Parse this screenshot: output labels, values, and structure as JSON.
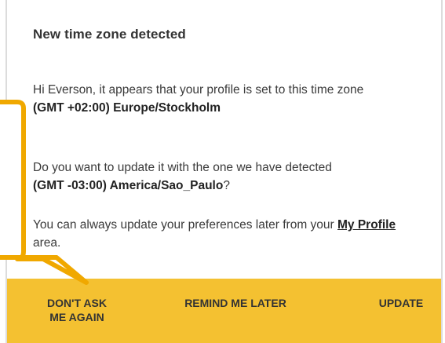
{
  "dialog": {
    "title": "New time zone detected",
    "greeting": "Hi Everson, it appears that your profile is set to this time zone",
    "current_zone": "(GMT +02:00) Europe/Stockholm",
    "question": "Do you want to update it with the one we have detected",
    "detected_zone": "(GMT -03:00) America/Sao_Paulo",
    "question_end": "?",
    "note_prefix": "You can always update your preferences later from your ",
    "note_link": "My Profile",
    "note_suffix": " area."
  },
  "footer": {
    "dont_ask_label": "DON'T ASK ME AGAIN",
    "remind_label": "REMIND ME LATER",
    "update_label": "UPDATE"
  },
  "colors": {
    "footer_background": "#f4c131",
    "callout_border": "#f0a800"
  }
}
